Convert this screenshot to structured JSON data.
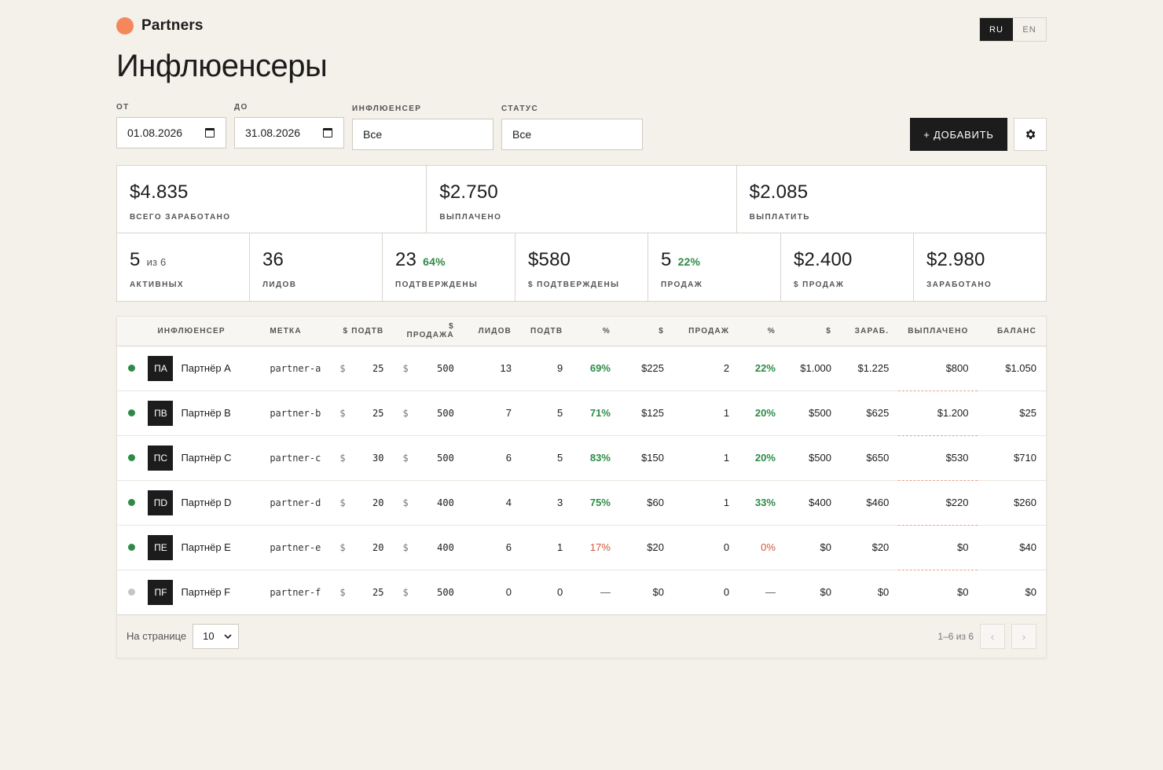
{
  "header": {
    "brand": "Partners",
    "lang": [
      "RU",
      "EN"
    ],
    "active_lang": "RU",
    "title": "Инфлюенсеры"
  },
  "filters": {
    "from_label": "ОТ",
    "from_value": "01.08.2026",
    "to_label": "ДО",
    "to_value": "31.08.2026",
    "influencer_label": "ИНФЛЮЕНСЕР",
    "influencer_value": "Все",
    "status_label": "СТАТУС",
    "status_value": "Все",
    "add_label": "+ ДОБАВИТЬ"
  },
  "stats_top": [
    {
      "value": "$4.835",
      "label": "ВСЕГО ЗАРАБОТАНО"
    },
    {
      "value": "$2.750",
      "label": "ВЫПЛАЧЕНО"
    },
    {
      "value": "$2.085",
      "label": "ВЫПЛАТИТЬ"
    }
  ],
  "stats_bottom": [
    {
      "value": "5",
      "sub": "из 6",
      "pct": "",
      "label": "АКТИВНЫХ"
    },
    {
      "value": "36",
      "sub": "",
      "pct": "",
      "label": "ЛИДОВ"
    },
    {
      "value": "23",
      "sub": "",
      "pct": "64%",
      "label": "ПОДТВЕРЖДЕНЫ"
    },
    {
      "value": "$580",
      "sub": "",
      "pct": "",
      "label": "$ ПОДТВЕРЖДЕНЫ"
    },
    {
      "value": "5",
      "sub": "",
      "pct": "22%",
      "label": "ПРОДАЖ"
    },
    {
      "value": "$2.400",
      "sub": "",
      "pct": "",
      "label": "$ ПРОДАЖ"
    },
    {
      "value": "$2.980",
      "sub": "",
      "pct": "",
      "label": "ЗАРАБОТАНО"
    }
  ],
  "table": {
    "columns": [
      "",
      "ИНФЛЮЕНСЕР",
      "МЕТКА",
      "$ ПОДТВ",
      "$ ПРОДАЖА",
      "ЛИДОВ",
      "ПОДТВ",
      "%",
      "$",
      "ПРОДАЖ",
      "%",
      "$",
      "ЗАРАБ.",
      "ВЫПЛАЧЕНО",
      "БАЛАНС"
    ],
    "currency": "$",
    "rows": [
      {
        "active": true,
        "initials": "ПА",
        "name": "Партнёр A",
        "tag": "partner-a",
        "cpa": "25",
        "cps": "500",
        "leads": "13",
        "conf": "9",
        "conf_pct": "69%",
        "conf_sum": "$225",
        "sales": "2",
        "sales_pct": "22%",
        "sales_sum": "$1.000",
        "earned": "$1.225",
        "paid": "$800",
        "balance": "$1.050"
      },
      {
        "active": true,
        "initials": "ПВ",
        "name": "Партнёр B",
        "tag": "partner-b",
        "cpa": "25",
        "cps": "500",
        "leads": "7",
        "conf": "5",
        "conf_pct": "71%",
        "conf_sum": "$125",
        "sales": "1",
        "sales_pct": "20%",
        "sales_sum": "$500",
        "earned": "$625",
        "paid": "$1.200",
        "balance": "$25"
      },
      {
        "active": true,
        "initials": "ПС",
        "name": "Партнёр C",
        "tag": "partner-c",
        "cpa": "30",
        "cps": "500",
        "leads": "6",
        "conf": "5",
        "conf_pct": "83%",
        "conf_sum": "$150",
        "sales": "1",
        "sales_pct": "20%",
        "sales_sum": "$500",
        "earned": "$650",
        "paid": "$530",
        "balance": "$710"
      },
      {
        "active": true,
        "initials": "ПD",
        "name": "Партнёр D",
        "tag": "partner-d",
        "cpa": "20",
        "cps": "400",
        "leads": "4",
        "conf": "3",
        "conf_pct": "75%",
        "conf_sum": "$60",
        "sales": "1",
        "sales_pct": "33%",
        "sales_sum": "$400",
        "earned": "$460",
        "paid": "$220",
        "balance": "$260"
      },
      {
        "active": true,
        "initials": "ПЕ",
        "name": "Партнёр E",
        "tag": "partner-e",
        "cpa": "20",
        "cps": "400",
        "leads": "6",
        "conf": "1",
        "conf_pct": "17%",
        "conf_sum": "$20",
        "sales": "0",
        "sales_pct": "0%",
        "sales_sum": "$0",
        "earned": "$20",
        "paid": "$0",
        "balance": "$40"
      },
      {
        "active": false,
        "initials": "ПF",
        "name": "Партнёр F",
        "tag": "partner-f",
        "cpa": "25",
        "cps": "500",
        "leads": "0",
        "conf": "0",
        "conf_pct": "—",
        "conf_sum": "$0",
        "sales": "0",
        "sales_pct": "—",
        "sales_sum": "$0",
        "earned": "$0",
        "paid": "$0",
        "balance": "$0"
      }
    ]
  },
  "footer": {
    "per_page_label": "На странице",
    "per_page_value": "10",
    "range": "1–6 из 6",
    "prev": "‹",
    "next": "›"
  },
  "colors": {
    "accent": "#f5875c",
    "active_dot": "#2e8b47",
    "inactive_dot": "#c8c4be",
    "good": "#2e8b47",
    "bad": "#d1573b"
  }
}
